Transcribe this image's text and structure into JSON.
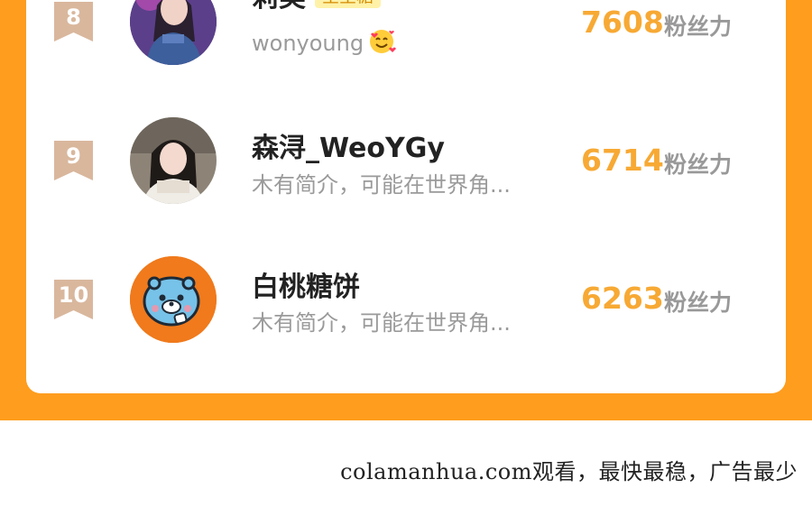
{
  "ranking": [
    {
      "rank": "8",
      "name": "莉美",
      "badge": "星星糖",
      "description": "wonyoung",
      "score": "7608",
      "unit": "粉丝力"
    },
    {
      "rank": "9",
      "name": "森浔_WeoYGy",
      "badge": "",
      "description": "木有简介，可能在世界角...",
      "score": "6714",
      "unit": "粉丝力"
    },
    {
      "rank": "10",
      "name": "白桃糖饼",
      "badge": "",
      "description": "木有简介，可能在世界角...",
      "score": "6263",
      "unit": "粉丝力"
    }
  ],
  "footer": {
    "text": "colamanhua.com观看，最快最稳，广告最少"
  },
  "colors": {
    "accent": "#ff9d1e",
    "score": "#f7a934",
    "rank_badge": "#d9b79d"
  }
}
